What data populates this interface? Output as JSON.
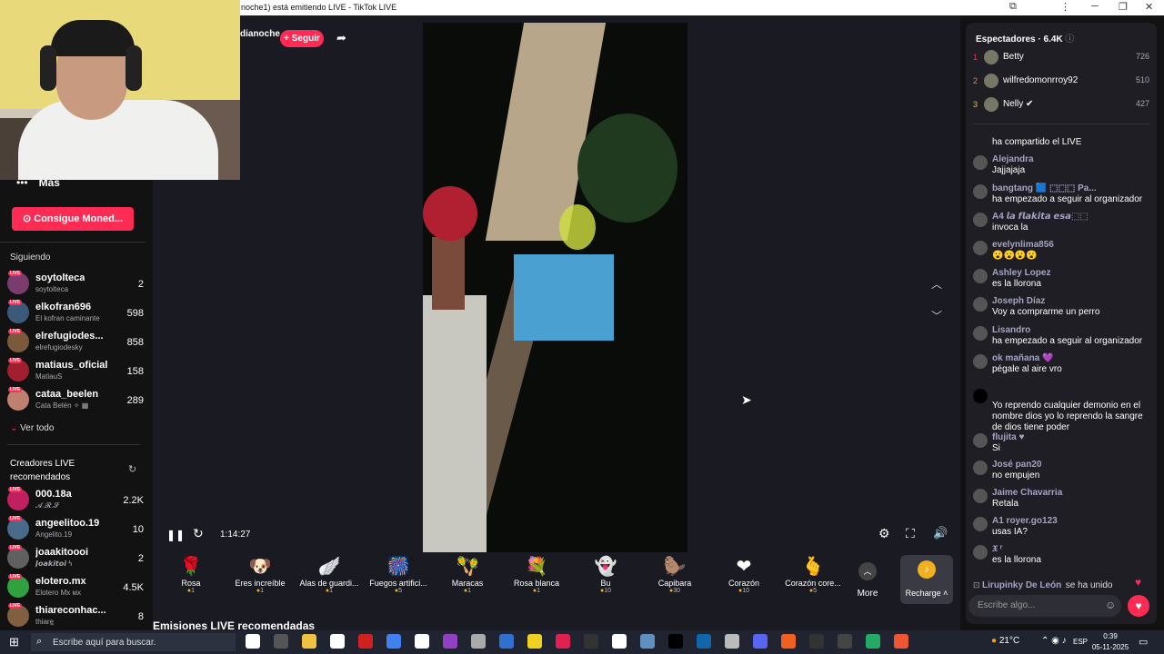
{
  "window": {
    "title": "noche1) está emitiendo LIVE - TikTok LIVE"
  },
  "stream": {
    "host_name": "dianoche",
    "follow_label": "+ Seguir",
    "elapsed": "1:14:27"
  },
  "sidebar": {
    "more_label": "Más",
    "coins_button": "Consigue Moned...",
    "following_header": "Siguiendo",
    "following": [
      {
        "name": "soytolteca",
        "sub": "soytolteca",
        "count": "2",
        "color": "#7a3b6e"
      },
      {
        "name": "elkofran696",
        "sub": "El kofran caminante",
        "count": "598",
        "color": "#3b5a7a"
      },
      {
        "name": "elrefugiodes...",
        "sub": "elrefugiodesky",
        "count": "858",
        "color": "#7a5a3b"
      },
      {
        "name": "matiaus_oficial",
        "sub": "MatiauS",
        "count": "158",
        "color": "#a02030"
      },
      {
        "name": "cataa_beelen",
        "sub": "Cata Belén ✧ ▦",
        "count": "289",
        "color": "#c08070"
      }
    ],
    "see_all": "Ver todo",
    "recommended_header": "Creadores LIVE recomendados",
    "recommended": [
      {
        "name": "000.18a",
        "sub": "𝓐.𝓡.𝓢",
        "count": "2.2K",
        "color": "#c02060"
      },
      {
        "name": "angeelitoo.19",
        "sub": "Angelito.19",
        "count": "10",
        "color": "#4a6a8a"
      },
      {
        "name": "joaakitoooi",
        "sub": "𝙅𝙤𝙖𝙠𝙞𝙩𝙤𝙞 ϟ",
        "count": "2",
        "color": "#606060"
      },
      {
        "name": "elotero.mx",
        "sub": "Elotero Mx ᴍx",
        "count": "4.5K",
        "color": "#30a040"
      },
      {
        "name": "thiareconhac...",
        "sub": "thiare͟͟",
        "count": "8",
        "color": "#806040"
      }
    ]
  },
  "recommended_section": "Emisiones LIVE recomendadas",
  "gifts": [
    {
      "name": "Rosa",
      "price": "1",
      "icon": "🌹"
    },
    {
      "name": "Eres increíble",
      "price": "1",
      "icon": "🐶"
    },
    {
      "name": "Alas de guardi...",
      "price": "1",
      "icon": "🪽"
    },
    {
      "name": "Fuegos artifici...",
      "price": "5",
      "icon": "🎆"
    },
    {
      "name": "Maracas",
      "price": "1",
      "icon": "🪇"
    },
    {
      "name": "Rosa blanca",
      "price": "1",
      "icon": "💐"
    },
    {
      "name": "Bu",
      "price": "10",
      "icon": "👻"
    },
    {
      "name": "Capibara",
      "price": "30",
      "icon": "🦫"
    },
    {
      "name": "Corazón",
      "price": "10",
      "icon": "❤"
    },
    {
      "name": "Corazón core...",
      "price": "5",
      "icon": "🫰"
    }
  ],
  "gift_more": "More",
  "recharge": "Recharge",
  "viewers": {
    "label": "Espectadores",
    "count": "6.4K",
    "top": [
      {
        "rank": "1",
        "name": "Betty",
        "score": "726",
        "rank_color": "#fe2c55"
      },
      {
        "rank": "2",
        "name": "wilfredomonrroy92",
        "score": "510",
        "rank_color": "#fe7a2c"
      },
      {
        "rank": "3",
        "name": "Nelly ✔",
        "score": "427",
        "rank_color": "#f0c030"
      }
    ]
  },
  "chat": [
    {
      "name": "",
      "text": "ha compartido el LIVE"
    },
    {
      "name": "Alejandra",
      "text": "Jajjajaja"
    },
    {
      "name": "bangtang 🟦 ⬚⬚⬚ Pa...",
      "text": "ha empezado a seguir al organizador"
    },
    {
      "name": "A4 𝙡𝙖 𝙛𝙡𝙖𝙠𝙞𝙩𝙖 𝙚𝙨𝙖⬚⬚",
      "text": "invoca la"
    },
    {
      "name": "evelynlima856",
      "text": "😮😮😮😮"
    },
    {
      "name": "Ashley Lopez",
      "text": "es la llorona"
    },
    {
      "name": "Joseph Díaz",
      "text": "Voy a comprarme un perro"
    },
    {
      "name": "Lisandro",
      "text": "ha empezado a seguir al organizador"
    },
    {
      "name": "ok mañana 💜",
      "text": "pégale al aire vro"
    },
    {
      "name": "",
      "text": "Yo reprendo cualquier demonio en el nombre dios yo lo reprendo la sangre de dios tiene poder"
    },
    {
      "name": "flujita ♥",
      "text": "Si"
    },
    {
      "name": "José pan20",
      "text": "no empujen"
    },
    {
      "name": "Jaime Chavarria",
      "text": "Retala"
    },
    {
      "name": "A1 royer.go123",
      "text": "usas IA?"
    },
    {
      "name": "𝔛 ʳ",
      "text": "es la llorona"
    }
  ],
  "chat_join": {
    "name": "Lirupinky De León",
    "text": "se ha unido"
  },
  "chat_placeholder": "Escribe algo...",
  "taskbar": {
    "search": "Escribe aquí para buscar.",
    "weather": "21°C",
    "lang": "ESP",
    "time": "0:39",
    "date": "05-11-2025"
  }
}
